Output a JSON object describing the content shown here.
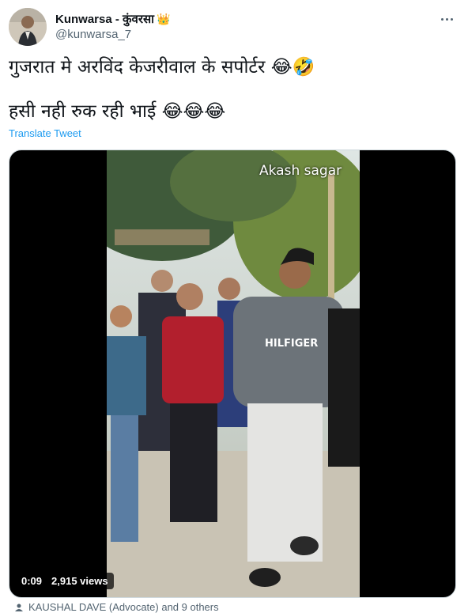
{
  "author": {
    "display_name": "Kunwarsa - कुंवरसा",
    "crown_emoji": "👑",
    "handle": "@kunwarsa_7"
  },
  "tweet": {
    "line1": "गुजरात मे अरविंद केजरीवाल के सपोर्टर 😂🤣",
    "line2": "हसी नही रुक रही भाई 😂😂😂",
    "translate_label": "Translate Tweet"
  },
  "video": {
    "watermark": "Akash sagar",
    "time": "0:09",
    "views": "2,915 views"
  },
  "footer": {
    "tagged_text": "KAUSHAL DAVE (Advocate) and 9 others"
  },
  "colors": {
    "accent": "#1d9bf0",
    "secondary_text": "#536471"
  },
  "icons": {
    "more": "more-horizontal-icon",
    "tag": "tag-person-icon"
  }
}
